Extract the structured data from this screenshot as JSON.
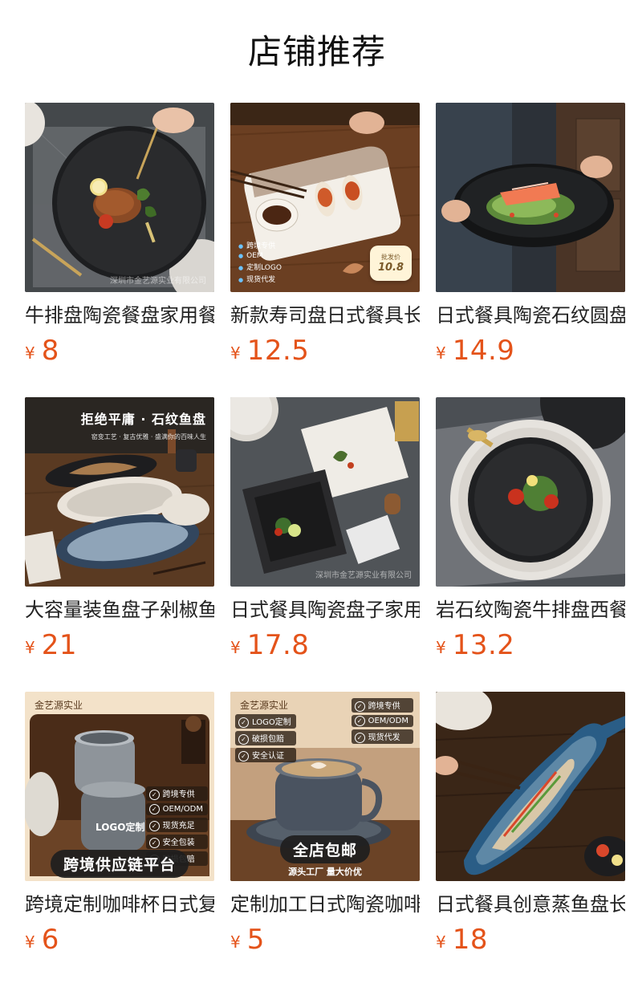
{
  "page": {
    "title": "店铺推荐"
  },
  "currency_symbol": "¥",
  "products": [
    {
      "name": "牛排盘陶瓷餐盘家用餐具",
      "price": "8",
      "image": {
        "theme": "steak-plate",
        "watermark": "深圳市金艺源实业有限公司"
      }
    },
    {
      "name": "新款寿司盘日式餐具长方",
      "price": "12.5",
      "image": {
        "theme": "sushi-plate",
        "tags": [
          "跨境专供",
          "OEM",
          "定制LOGO",
          "现货代发"
        ],
        "badge_label": "批发价",
        "badge_value": "10.8"
      }
    },
    {
      "name": "日式餐具陶瓷石纹圆盘",
      "price": "14.9",
      "image": {
        "theme": "salmon-plate"
      }
    },
    {
      "name": "大容量装鱼盘子剁椒鱼头",
      "price": "21",
      "image": {
        "theme": "fish-plates",
        "headline": "拒绝平庸 · 石纹鱼盘",
        "subline": "窑变工艺 · 复古优雅 · 盛满你的百味人生"
      }
    },
    {
      "name": "日式餐具陶瓷盘子家用",
      "price": "17.8",
      "image": {
        "theme": "square-plates",
        "watermark": "深圳市金艺源实业有限公司"
      }
    },
    {
      "name": "岩石纹陶瓷牛排盘西餐",
      "price": "13.2",
      "image": {
        "theme": "rock-plate"
      }
    },
    {
      "name": "跨境定制咖啡杯日式复古",
      "price": "6",
      "image": {
        "theme": "cups",
        "brand": "金艺源实业",
        "features": [
          "跨境专供",
          "OEM/ODM",
          "现货充足",
          "安全包装",
          "破损包赔"
        ],
        "logo_text": "LOGO定制",
        "banner": "跨境供应链平台"
      }
    },
    {
      "name": "定制加工日式陶瓷咖啡杯",
      "price": "5",
      "image": {
        "theme": "coffee",
        "brand": "金艺源实业",
        "features_left": [
          "LOGO定制",
          "破损包赔",
          "安全认证"
        ],
        "features_right": [
          "跨境专供",
          "OEM/ODM",
          "现货代发"
        ],
        "banner": "全店包邮",
        "subline": "源头工厂 量大价优"
      }
    },
    {
      "name": "日式餐具创意蒸鱼盘长",
      "price": "18",
      "image": {
        "theme": "fish-shaped-plate"
      }
    }
  ]
}
